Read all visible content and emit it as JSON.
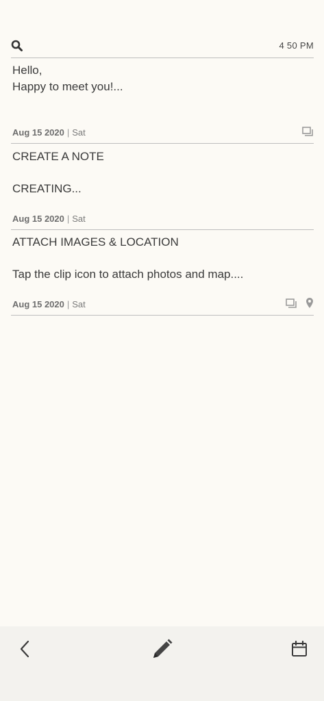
{
  "header": {
    "time": "4 50 PM"
  },
  "notes": [
    {
      "lines": [
        "Hello,",
        "Happy to meet you!..."
      ],
      "date": "Aug 15 2020",
      "separator": "|",
      "day": "Sat",
      "icons": [
        "gallery-icon"
      ]
    },
    {
      "lines": [
        "CREATE A NOTE",
        "",
        "CREATING..."
      ],
      "date": "Aug 15 2020",
      "separator": "|",
      "day": "Sat",
      "icons": []
    },
    {
      "lines": [
        "ATTACH IMAGES & LOCATION",
        "",
        "Tap the clip icon to attach photos and map...."
      ],
      "date": "Aug 15 2020",
      "separator": "|",
      "day": "Sat",
      "icons": [
        "gallery-icon",
        "location-pin-icon"
      ]
    }
  ],
  "bottom_bar": {
    "icons": [
      "back-arrow-icon",
      "pencil-icon",
      "calendar-icon"
    ]
  },
  "colors": {
    "background": "#fcfaf5",
    "bottom_bar": "#f3f2ee",
    "divider": "#bdbdbd",
    "text": "#3a3a3a",
    "icon": "#9a9a9a"
  }
}
